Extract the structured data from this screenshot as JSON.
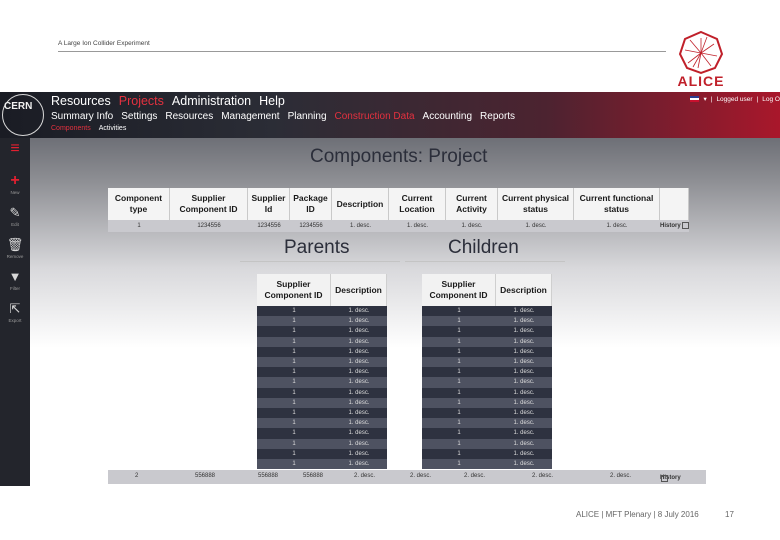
{
  "slide": {
    "header_text": "A Large Ion Collider Experiment",
    "logo_text": "ALICE",
    "footer_text": "ALICE | MFT Plenary | 8 July 2016",
    "page_number": "17"
  },
  "app": {
    "cern_logo_text": "CERN",
    "nav1": [
      {
        "label": "Resources",
        "active": false
      },
      {
        "label": "Projects",
        "active": true
      },
      {
        "label": "Administration",
        "active": false
      },
      {
        "label": "Help",
        "active": false
      }
    ],
    "nav2": [
      {
        "label": "Summary Info",
        "active": false
      },
      {
        "label": "Settings",
        "active": false
      },
      {
        "label": "Resources",
        "active": false
      },
      {
        "label": "Management",
        "active": false
      },
      {
        "label": "Planning",
        "active": false
      },
      {
        "label": "Construction Data",
        "active": true
      },
      {
        "label": "Accounting",
        "active": false
      },
      {
        "label": "Reports",
        "active": false
      }
    ],
    "nav3": [
      {
        "label": "Components",
        "active": true
      },
      {
        "label": "Activities",
        "active": false
      }
    ],
    "user": {
      "language_icon": "uk-flag-icon",
      "name": "Logged user",
      "separator": "|",
      "logout": "Log O"
    },
    "sidebar": [
      {
        "icon": "menu-icon",
        "glyph": "≡",
        "label": ""
      },
      {
        "icon": "add-icon",
        "glyph": "+",
        "label": "New"
      },
      {
        "icon": "edit-icon",
        "glyph": "✎",
        "label": "Edit"
      },
      {
        "icon": "trash-icon",
        "glyph": "🗑",
        "label": "Remove"
      },
      {
        "icon": "filter-icon",
        "glyph": "▼",
        "label": "Filter"
      },
      {
        "icon": "export-icon",
        "glyph": "⇱",
        "label": "Export"
      }
    ],
    "accent_color": "#e3313f"
  },
  "components": {
    "title": "Components: Project",
    "columns": [
      "Component type",
      "Supplier Component ID",
      "Supplier Id",
      "Package ID",
      "Description",
      "Current Location",
      "Current Activity",
      "Current physical status",
      "Current functional status"
    ],
    "row": [
      "1",
      "1234556",
      "1234556",
      "1234556",
      "1. desc.",
      "1. desc.",
      "1. desc.",
      "1. desc.",
      "1. desc."
    ],
    "history_label": "History",
    "bottom_row": [
      "2",
      "556888",
      "556888",
      "556888",
      "2. desc.",
      "2. desc.",
      "2. desc.",
      "2. desc.",
      "2. desc."
    ]
  },
  "parents": {
    "title": "Parents",
    "columns": [
      "Supplier Component ID",
      "Description"
    ],
    "rows": [
      [
        "1",
        "1. desc."
      ],
      [
        "1",
        "1. desc."
      ],
      [
        "1",
        "1. desc."
      ],
      [
        "1",
        "1. desc."
      ],
      [
        "1",
        "1. desc."
      ],
      [
        "1",
        "1. desc."
      ],
      [
        "1",
        "1. desc."
      ],
      [
        "1",
        "1. desc."
      ],
      [
        "1",
        "1. desc."
      ],
      [
        "1",
        "1. desc."
      ],
      [
        "1",
        "1. desc."
      ],
      [
        "1",
        "1. desc."
      ],
      [
        "1",
        "1. desc."
      ],
      [
        "1",
        "1. desc."
      ],
      [
        "1",
        "1. desc."
      ],
      [
        "1",
        "1. desc."
      ]
    ]
  },
  "children": {
    "title": "Children",
    "columns": [
      "Supplier Component ID",
      "Description"
    ],
    "rows": [
      [
        "1",
        "1. desc."
      ],
      [
        "1",
        "1. desc."
      ],
      [
        "1",
        "1. desc."
      ],
      [
        "1",
        "1. desc."
      ],
      [
        "1",
        "1. desc."
      ],
      [
        "1",
        "1. desc."
      ],
      [
        "1",
        "1. desc."
      ],
      [
        "1",
        "1. desc."
      ],
      [
        "1",
        "1. desc."
      ],
      [
        "1",
        "1. desc."
      ],
      [
        "1",
        "1. desc."
      ],
      [
        "1",
        "1. desc."
      ],
      [
        "1",
        "1. desc."
      ],
      [
        "1",
        "1. desc."
      ],
      [
        "1",
        "1. desc."
      ],
      [
        "1",
        "1. desc."
      ]
    ]
  }
}
